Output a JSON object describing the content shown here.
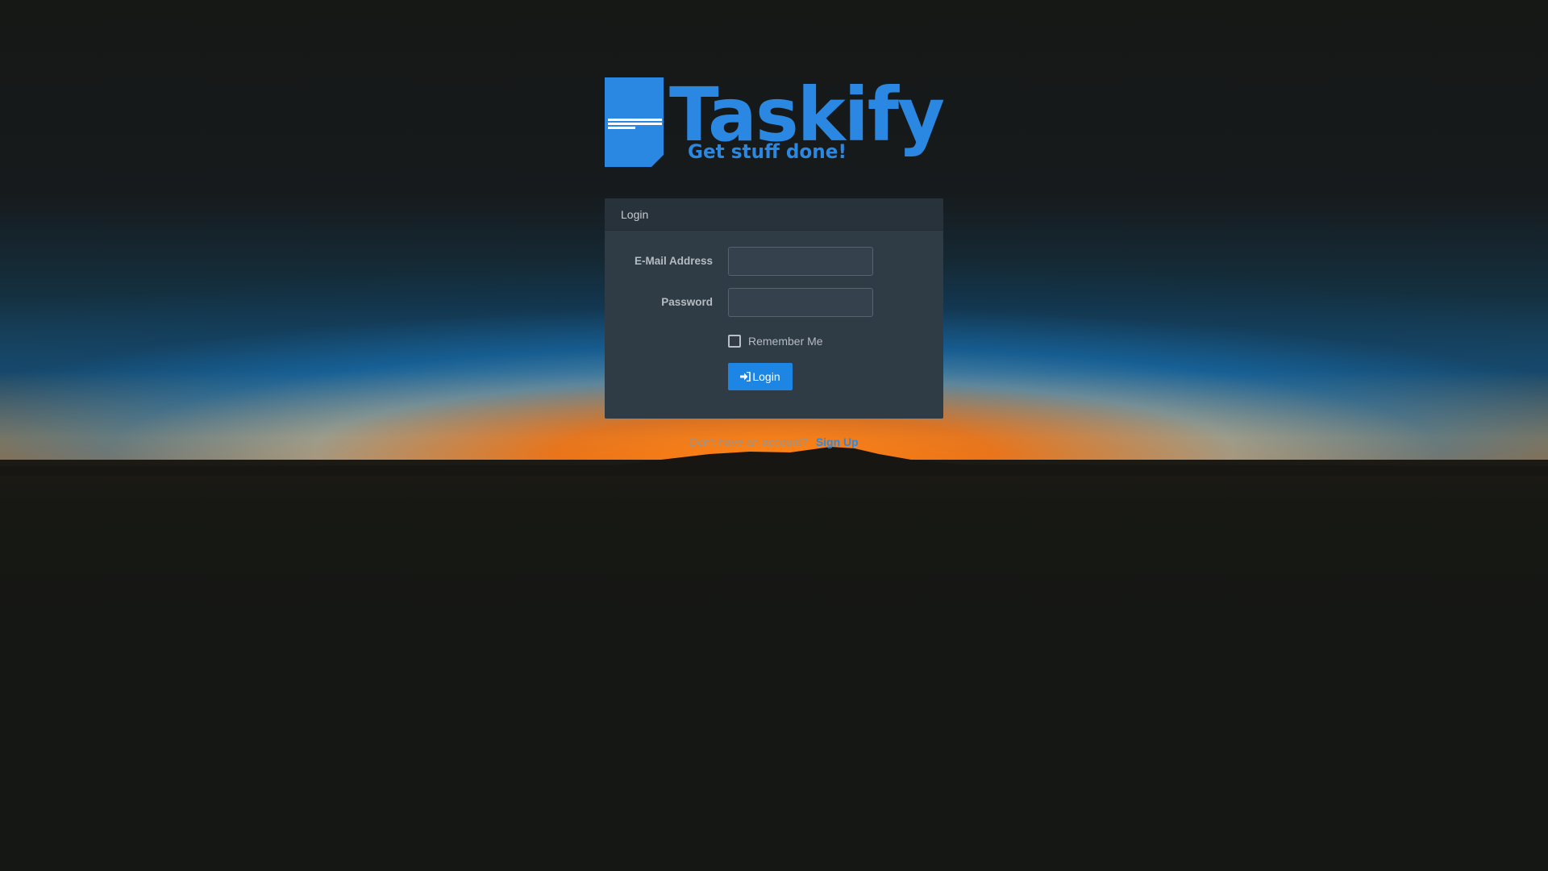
{
  "app": {
    "name": "Taskify",
    "tagline": "Get stuff done!"
  },
  "colors": {
    "brand": "#2b88e2",
    "panel": "#2f3b45",
    "panel_header": "#27323b",
    "button": "#1d85e3",
    "link": "#2a8ae6"
  },
  "login_panel": {
    "title": "Login",
    "email_label": "E-Mail Address",
    "email_value": "",
    "password_label": "Password",
    "password_value": "",
    "remember_label": "Remember Me",
    "remember_checked": false,
    "submit_label": "Login",
    "submit_icon": "sign-in-icon"
  },
  "footer": {
    "prompt": "Don't have an account?",
    "signup_label": "Sign Up"
  }
}
